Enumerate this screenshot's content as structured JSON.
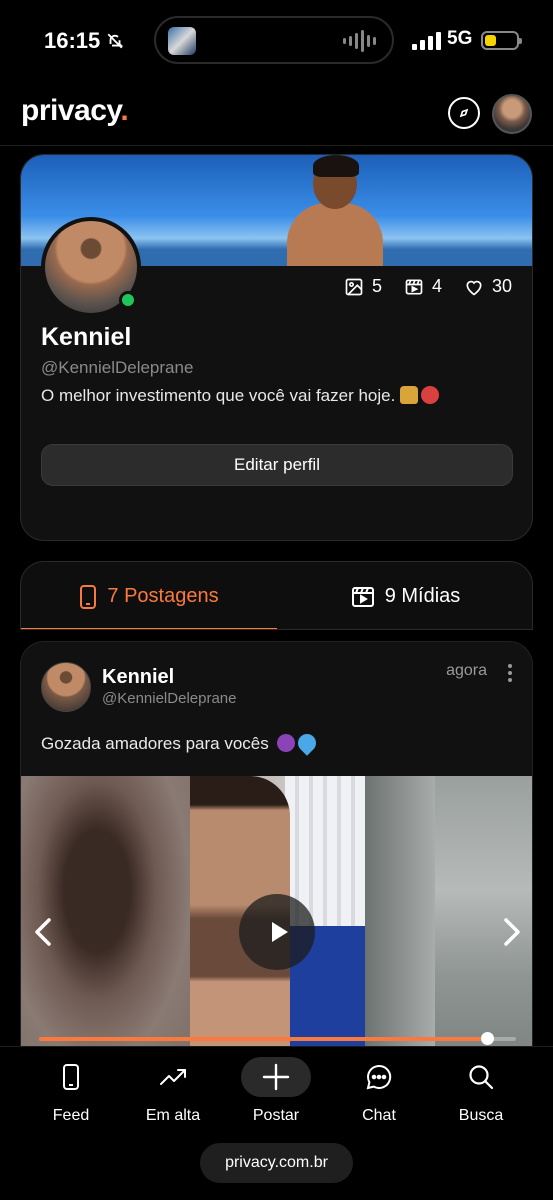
{
  "status_bar": {
    "time": "16:15",
    "network": "5G"
  },
  "app": {
    "logo_text": "privacy",
    "logo_dot": ".",
    "accent_color": "#f97a3c"
  },
  "profile": {
    "name": "Kenniel",
    "handle": "@KennielDeleprane",
    "bio": "O melhor investimento que você vai fazer hoje.",
    "online_color": "#1ec55a",
    "stats": {
      "images": "5",
      "videos": "4",
      "likes": "30"
    },
    "edit_label": "Editar perfil"
  },
  "tabs": [
    {
      "label": "7 Postagens",
      "icon": "phone-icon",
      "active": true
    },
    {
      "label": "9 Mídias",
      "icon": "clapperboard-icon",
      "active": false
    }
  ],
  "post": {
    "author": "Kenniel",
    "handle": "@KennielDeleprane",
    "time": "agora",
    "text": "Gozada amadores para vocês",
    "video_progress": 0.94
  },
  "nav": [
    {
      "label": "Feed",
      "icon": "phone-icon"
    },
    {
      "label": "Em alta",
      "icon": "trending-icon"
    },
    {
      "label": "Postar",
      "icon": "plus-icon"
    },
    {
      "label": "Chat",
      "icon": "chat-icon"
    },
    {
      "label": "Busca",
      "icon": "search-icon"
    }
  ],
  "browser": {
    "url": "privacy.com.br"
  }
}
